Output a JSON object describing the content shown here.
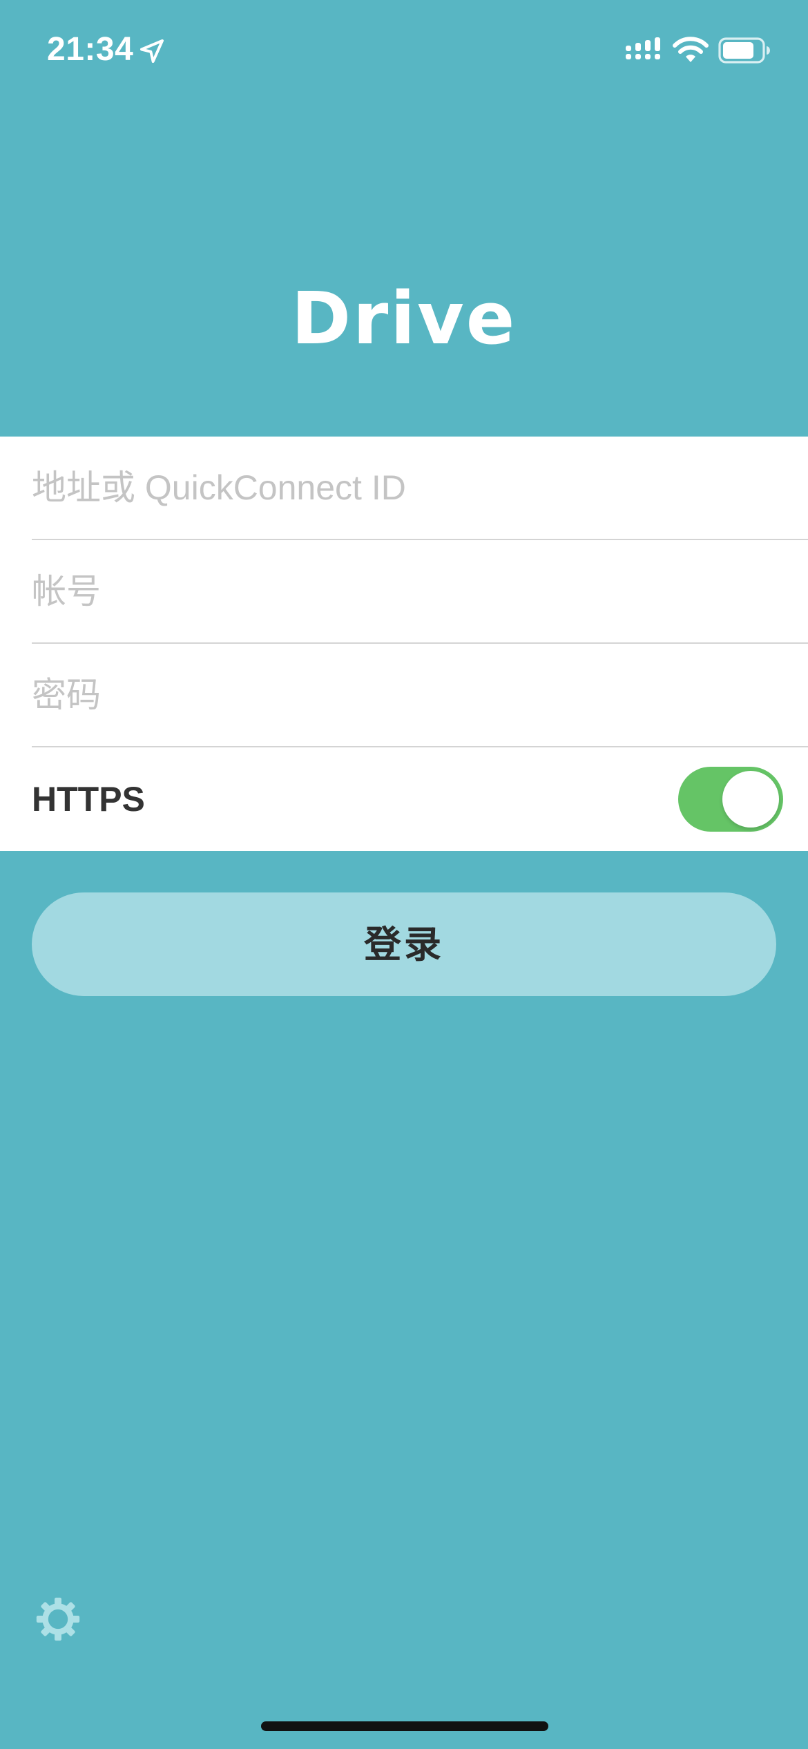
{
  "status_bar": {
    "time": "21:34",
    "icons": [
      "location-arrow-icon",
      "signal-icon",
      "wifi-icon",
      "battery-icon"
    ]
  },
  "header": {
    "title": "Drive"
  },
  "form": {
    "address": {
      "placeholder": "地址或 QuickConnect ID",
      "value": ""
    },
    "account": {
      "placeholder": "帐号",
      "value": ""
    },
    "password": {
      "placeholder": "密码",
      "value": ""
    },
    "https": {
      "label": "HTTPS",
      "enabled": true
    }
  },
  "login_button": {
    "label": "登录"
  },
  "footer": {
    "settings_icon": "gear-icon"
  },
  "colors": {
    "background": "#58b6c3",
    "button": "#a2d9e1",
    "toggle_on": "#65c466"
  }
}
